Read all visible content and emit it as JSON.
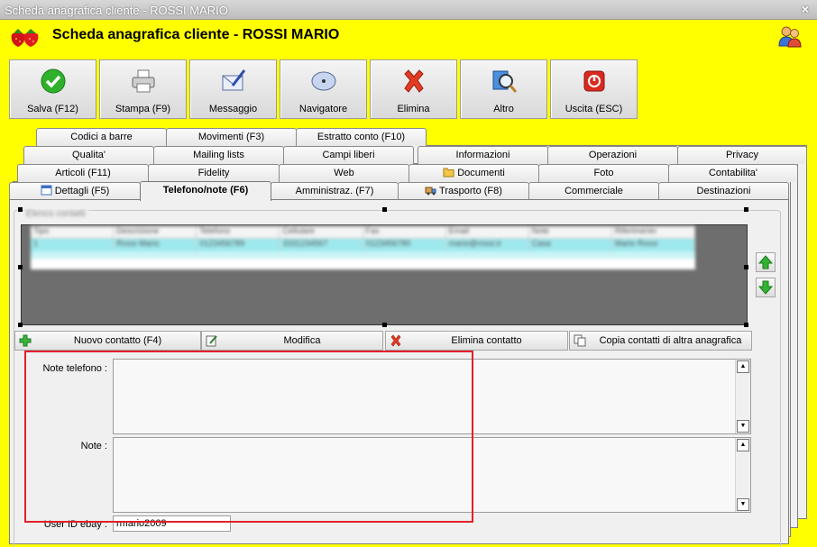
{
  "window": {
    "title": "Scheda anagrafica cliente - ROSSI MARIO",
    "close_glyph": "×"
  },
  "header": {
    "title": "Scheda anagrafica cliente - ROSSI MARIO"
  },
  "toolbar": {
    "buttons": [
      {
        "label": "Salva (F12)",
        "icon": "check-icon"
      },
      {
        "label": "Stampa (F9)",
        "icon": "printer-icon"
      },
      {
        "label": "Messaggio",
        "icon": "message-icon"
      },
      {
        "label": "Navigatore",
        "icon": "compass-icon"
      },
      {
        "label": "Elimina",
        "icon": "delete-icon"
      },
      {
        "label": "Altro",
        "icon": "search-icon"
      },
      {
        "label": "Uscita (ESC)",
        "icon": "exit-icon"
      }
    ]
  },
  "tabs": {
    "row1": [
      "Codici a barre",
      "Movimenti (F3)",
      "Estratto conto (F10)"
    ],
    "row2": [
      "Qualita'",
      "Mailing lists",
      "Campi liberi",
      "Informazioni",
      "Operazioni",
      "Privacy"
    ],
    "row3": [
      "Articoli (F11)",
      "Fidelity",
      "Web",
      "Documenti",
      "Foto",
      "Contabilita'"
    ],
    "row4": [
      "Dettagli (F5)",
      "Telefono/note (F6)",
      "Amministraz. (F7)",
      "Trasporto (F8)",
      "Commerciale",
      "Destinazioni"
    ],
    "active": "Telefono/note (F6)"
  },
  "contacts": {
    "group_label": "Elenco contatti",
    "columns": [
      "Tipo",
      "Descrizione",
      "Telefono",
      "Cellulare",
      "Fax",
      "Email",
      "Note",
      "Riferimento"
    ],
    "rows": [
      [
        "1",
        "Rossi Mario",
        "0123456789",
        "3331234567",
        "0123456780",
        "mario@rossi.it",
        "Casa",
        "Mario Rossi"
      ]
    ]
  },
  "actions": {
    "new_contact": "Nuovo contatto (F4)",
    "edit": "Modifica",
    "delete_contact": "Elimina contatto",
    "copy_contacts": "Copia contatti di altra anagrafica"
  },
  "fields": {
    "note_telefono_label": "Note telefono :",
    "note_telefono_value": "",
    "note_label": "Note :",
    "note_value": "",
    "user_id_ebay_label": "User ID ebay :",
    "user_id_ebay_value": "rmario2009"
  },
  "colors": {
    "background": "#ffff00",
    "highlight": "#e2202a",
    "grid_selected_row": "#9ee9ee"
  }
}
